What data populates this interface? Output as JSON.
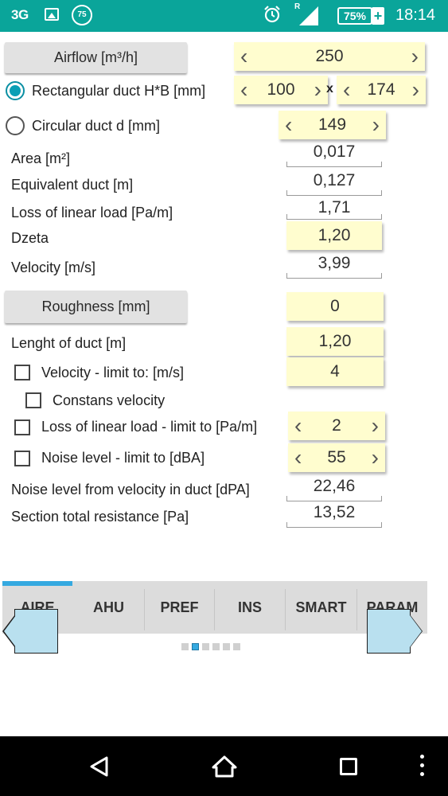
{
  "status_bar": {
    "network": "3G",
    "notification_badge": "75",
    "roaming": "R",
    "battery": "75%",
    "charging": "+",
    "time": "18:14",
    "bg_color": "#0aa59a"
  },
  "airflow": {
    "button_label": "Airflow [m³/h]",
    "value": "250"
  },
  "rect_duct": {
    "label": "Rectangular duct H*B [mm]",
    "selected": true,
    "h_value": "100",
    "separator": "x",
    "b_value": "174"
  },
  "circ_duct": {
    "label": "Circular duct d [mm]",
    "selected": false,
    "value": "149"
  },
  "area": {
    "label": "Area [m²]",
    "value": "0,017"
  },
  "equivalent": {
    "label": "Equivalent duct [m]",
    "value": "0,127"
  },
  "linear_loss": {
    "label": "Loss of linear load [Pa/m]",
    "value": "1,71"
  },
  "dzeta": {
    "label": "Dzeta",
    "value": "1,20"
  },
  "velocity": {
    "label": "Velocity [m/s]",
    "value": "3,99"
  },
  "roughness": {
    "button_label": "Roughness [mm]",
    "value": "0"
  },
  "length": {
    "label": "Lenght of duct [m]",
    "value": "1,20"
  },
  "velocity_limit": {
    "label": "Velocity - limit to: [m/s]",
    "checked": false,
    "value": "4"
  },
  "constans_velocity": {
    "label": "Constans velocity",
    "checked": false
  },
  "loss_limit": {
    "label": "Loss of linear load - limit to [Pa/m]",
    "checked": false,
    "value": "2"
  },
  "noise_limit": {
    "label": "Noise level - limit to [dBA]",
    "checked": false,
    "value": "55"
  },
  "noise_from_velocity": {
    "label": "Noise level from velocity in duct [dPA]",
    "value": "22,46"
  },
  "section_resistance": {
    "label": "Section total resistance [Pa]",
    "value": "13,52"
  },
  "tabs": [
    {
      "label": "AIRE",
      "active": true
    },
    {
      "label": "AHU",
      "active": false
    },
    {
      "label": "PREF",
      "active": false
    },
    {
      "label": "INS",
      "active": false
    },
    {
      "label": "SMART",
      "active": false
    },
    {
      "label": "PARAM",
      "active": false
    }
  ],
  "page_indicator": {
    "count": 6,
    "active_index": 1
  },
  "colors": {
    "accent": "#35a9e0",
    "input_bg": "#fffdcf",
    "button_bg": "#e2e2e2",
    "nav_arrow_bg": "#b9e0ef"
  }
}
